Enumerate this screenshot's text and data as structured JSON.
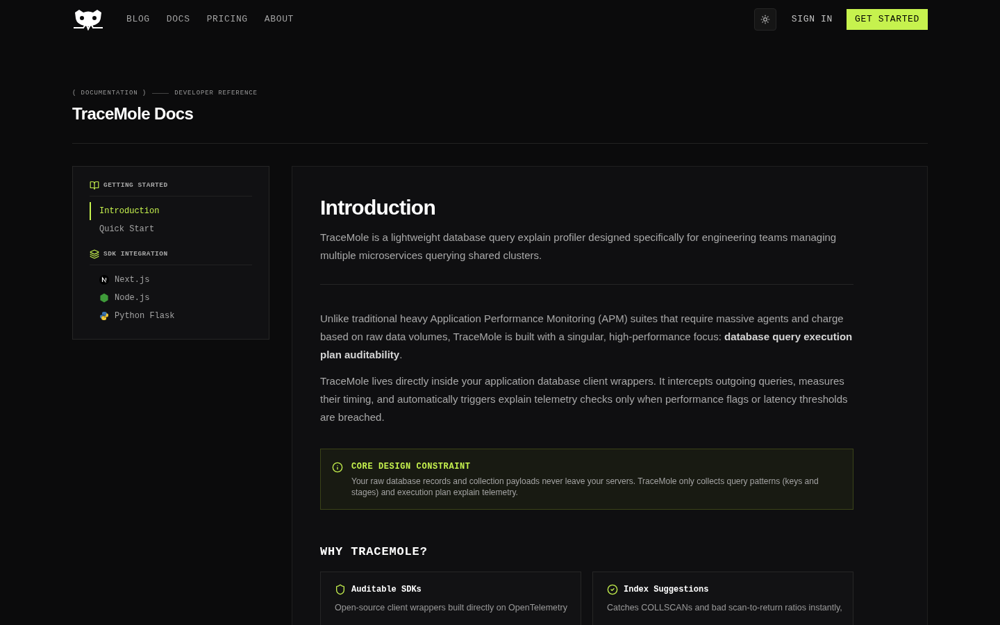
{
  "nav": {
    "links": [
      "BLOG",
      "DOCS",
      "PRICING",
      "ABOUT"
    ],
    "sign_in": "SIGN IN",
    "cta": "GET STARTED"
  },
  "breadcrumb": {
    "section": "( DOCUMENTATION )",
    "page": "DEVELOPER REFERENCE"
  },
  "page_title": "TraceMole Docs",
  "sidebar": [
    {
      "heading": "GETTING STARTED",
      "kind": "book",
      "items": [
        {
          "label": "Introduction",
          "selected": true
        },
        {
          "label": "Quick Start",
          "selected": false
        }
      ]
    },
    {
      "heading": "SDK INTEGRATION",
      "kind": "layers",
      "items": [
        {
          "label": "Next.js",
          "selected": false,
          "kind": "next"
        },
        {
          "label": "Node.js",
          "selected": false,
          "kind": "node"
        },
        {
          "label": "Python Flask",
          "selected": false,
          "kind": "python"
        }
      ]
    }
  ],
  "article": {
    "title": "Introduction",
    "lead": "TraceMole is a lightweight database query explain profiler designed specifically for engineering teams managing multiple microservices querying shared clusters.",
    "paragraphs": [
      "Unlike traditional heavy Application Performance Monitoring (APM) suites that require massive agents and charge based on raw data volumes, TraceMole is built with a singular, high-performance focus: **database query execution plan auditability**.",
      "TraceMole lives directly inside your application database client wrappers. It intercepts outgoing queries, measures their timing, and automatically triggers explain telemetry checks only when performance flags or latency thresholds are breached."
    ],
    "callout": {
      "title": "CORE DESIGN CONSTRAINT",
      "text": "Your raw database records and collection payloads never leave your servers. TraceMole only collects query patterns (keys and stages) and execution plan explain telemetry."
    },
    "section_title": "WHY TRACEMOLE?",
    "features": [
      {
        "kind": "shield",
        "title": "Auditable SDKs",
        "text": "Open-source client wrappers built directly on OpenTelemetry"
      },
      {
        "kind": "check",
        "title": "Index Suggestions",
        "text": "Catches COLLSCANs and bad scan-to-return ratios instantly,"
      }
    ]
  }
}
